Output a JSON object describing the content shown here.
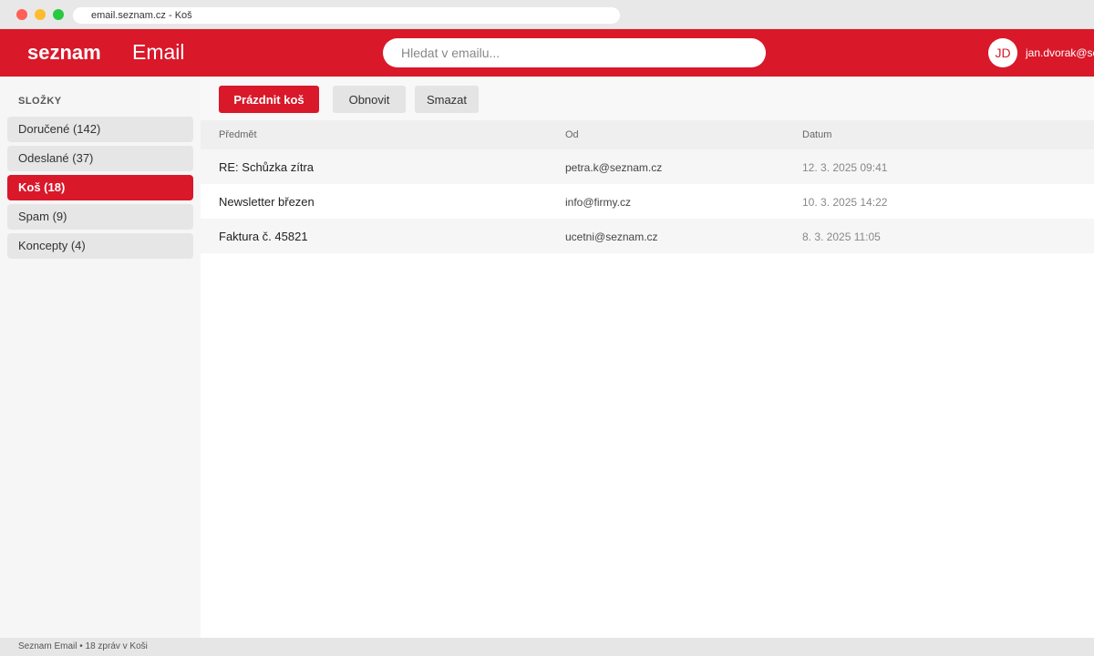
{
  "browser": {
    "url": "email.seznam.cz - Koš"
  },
  "header": {
    "logo": "seznam",
    "product": "Email",
    "search_placeholder": "Hledat v emailu...",
    "avatar_initials": "JD",
    "user_email": "jan.dvorak@seznam.cz"
  },
  "sidebar": {
    "heading": "SLOŽKY",
    "folders": [
      {
        "label": "Doručené (142)"
      },
      {
        "label": "Odeslané (37)"
      },
      {
        "label": "Koš (18)"
      },
      {
        "label": "Spam (9)"
      },
      {
        "label": "Koncepty (4)"
      }
    ],
    "active_index": 2
  },
  "toolbar": {
    "empty_trash_label": "Prázdnit koš",
    "refresh_label": "Obnovit",
    "delete_label": "Smazat"
  },
  "table": {
    "columns": [
      "Předmět",
      "Od",
      "Datum"
    ],
    "rows": [
      {
        "subject": "RE: Schůzka zítra",
        "from": "petra.k@seznam.cz",
        "date": "12. 3. 2025 09:41"
      },
      {
        "subject": "Newsletter březen",
        "from": "info@firmy.cz",
        "date": "10. 3. 2025 14:22"
      },
      {
        "subject": "Faktura č. 45821",
        "from": "ucetni@seznam.cz",
        "date": "8. 3. 2025 11:05"
      }
    ]
  },
  "footer": {
    "status": "Seznam Email • 18 zpráv v Koši"
  },
  "colors": {
    "brand": "#d9182a",
    "sidebar_bg": "#f6f6f6"
  }
}
